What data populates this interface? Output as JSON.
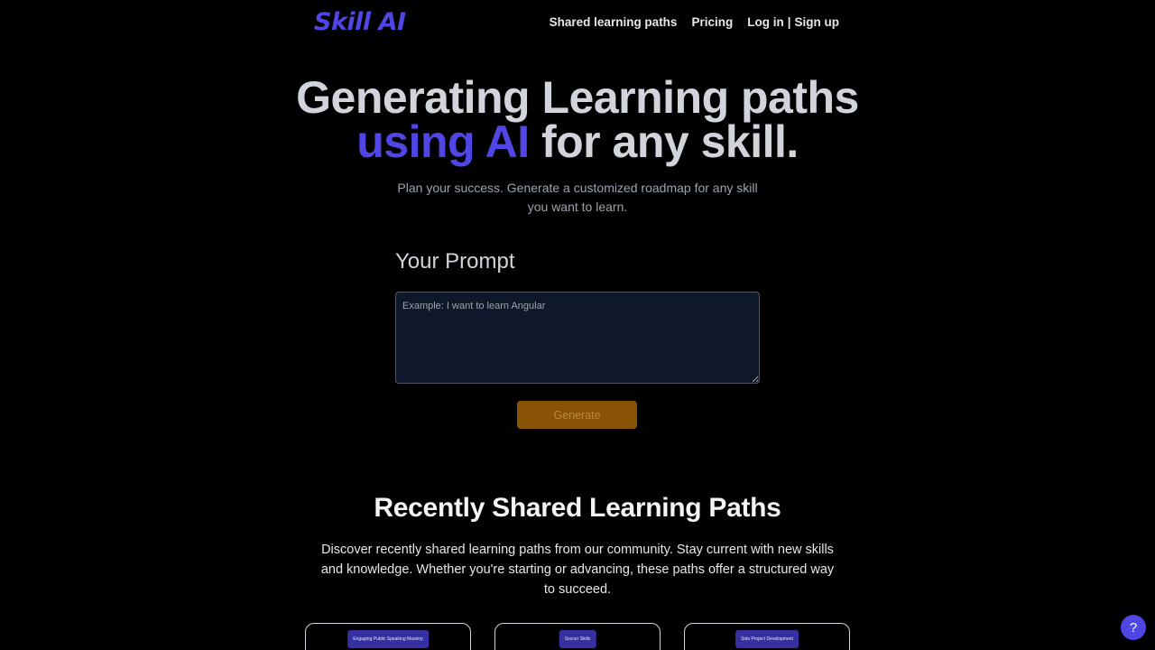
{
  "header": {
    "logo": "Skill AI",
    "nav": {
      "shared_paths": "Shared learning paths",
      "pricing": "Pricing",
      "login": "Log in",
      "separator": "|",
      "signup": "Sign up"
    }
  },
  "hero": {
    "line1": "Generating Learning paths",
    "line2_accent": "using AI",
    "line2_rest": " for any skill.",
    "subtitle": "Plan your success. Generate a customized roadmap for any skill you want to learn."
  },
  "prompt": {
    "label": "Your Prompt",
    "placeholder": "Example: I want to learn Angular",
    "value": "",
    "button": "Generate"
  },
  "shared_section": {
    "title": "Recently Shared Learning Paths",
    "description": "Discover recently shared learning paths from our community. Stay current with new skills and knowledge. Whether you're starting or advancing, these paths offer a structured way to succeed.",
    "cards": [
      {
        "tag": "Engaging Public Speaking Mastery"
      },
      {
        "tag": "Soccer Skills"
      },
      {
        "tag": "Side Project Development"
      }
    ]
  },
  "help_button": "?",
  "colors": {
    "accent": "#4f46e5",
    "background": "#000000",
    "generate_button": "#a16207",
    "input_bg": "#0f172a"
  }
}
